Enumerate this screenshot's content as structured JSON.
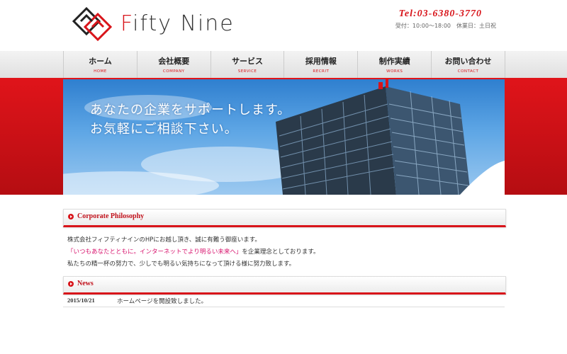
{
  "header": {
    "logo_text_accent": "F",
    "logo_text_rest": "ifty Nine",
    "tel": "Tel:03-6380-3770",
    "hours": "受付：10:00〜18:00　休業日：土日祝"
  },
  "nav": [
    {
      "ja": "ホーム",
      "en": "HOME"
    },
    {
      "ja": "会社概要",
      "en": "COMPANY"
    },
    {
      "ja": "サービス",
      "en": "SERVICE"
    },
    {
      "ja": "採用情報",
      "en": "RECRIT"
    },
    {
      "ja": "制作実績",
      "en": "WORKS"
    },
    {
      "ja": "お問い合わせ",
      "en": "CONTACT"
    }
  ],
  "hero": {
    "line1": "あなたの企業をサポートします。",
    "line2": "お気軽にご相談下さい。"
  },
  "philosophy": {
    "title": "Corporate Philosophy",
    "p1": "株式会社フィフティナインのHPにお越し頂き、誠に有難う御座います。",
    "p2_pink": "「いつもあなたとともに。インターネットでより明るい未来へ」",
    "p2_rest": "を企業理念としております。",
    "p3": "私たちの精一杯の努力で、少しでも明るい気持ちになって頂ける様に努力致します。"
  },
  "news": {
    "title": "News",
    "items": [
      {
        "date": "2015/10/21",
        "text": "ホームページを開設致しました。"
      }
    ]
  },
  "colors": {
    "accent": "#d8141a",
    "pink": "#d8146e"
  }
}
